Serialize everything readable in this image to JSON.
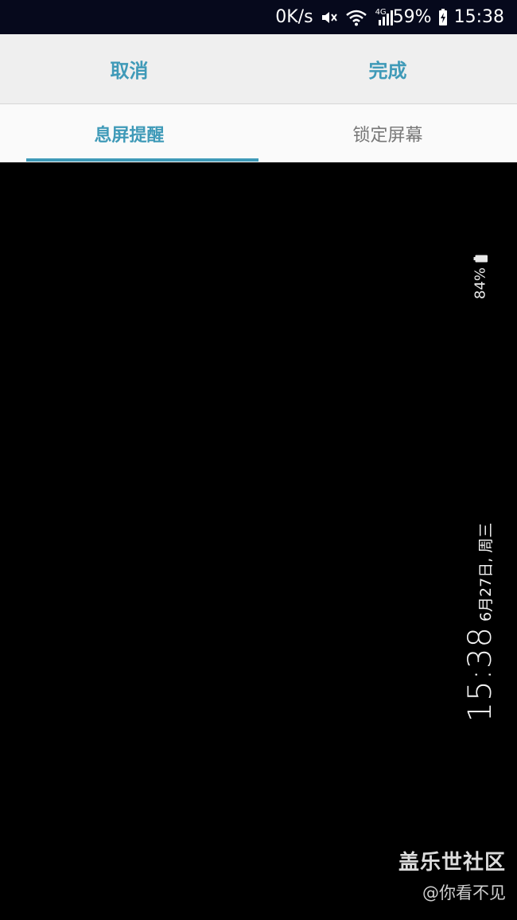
{
  "status_bar": {
    "net_speed": "0K/s",
    "icons": [
      "mute-icon",
      "wifi-icon",
      "signal-4g-icon",
      "battery-charging-icon"
    ],
    "network_type": "4G",
    "battery": "59%",
    "time": "15:38"
  },
  "action_bar": {
    "cancel_label": "取消",
    "done_label": "完成"
  },
  "tabs": [
    {
      "label": "息屏提醒",
      "active": true
    },
    {
      "label": "锁定屏幕",
      "active": false
    }
  ],
  "preview": {
    "battery_percent": "84%",
    "time": "15:38",
    "date": "6月27日, 周三"
  },
  "watermark": {
    "title": "盖乐世社区",
    "user": "@你看不见"
  },
  "colors": {
    "accent": "#3f9ab8",
    "status_bar_bg": "#06091c",
    "action_bar_bg": "#efefef",
    "preview_bg": "#000000"
  }
}
